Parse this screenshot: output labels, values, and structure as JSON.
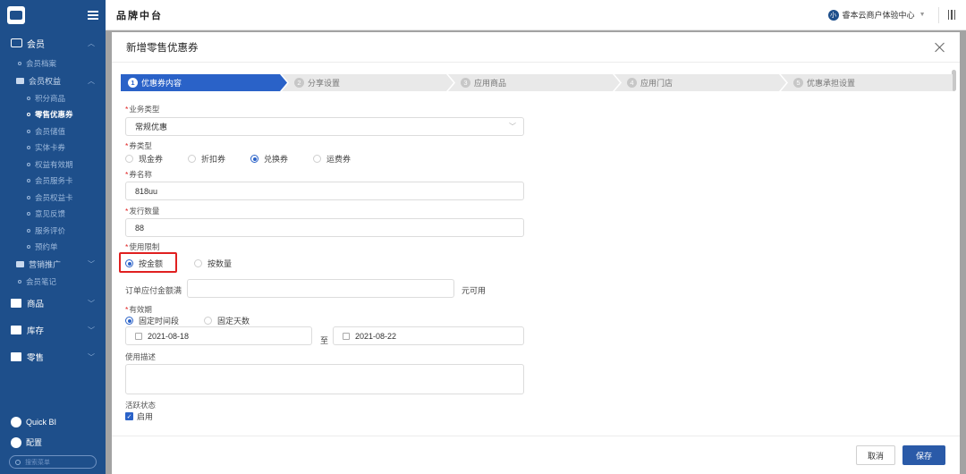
{
  "header": {
    "app_title": "品牌中台",
    "tenant_avatar": "小",
    "tenant_name": "睿本云商户体验中心"
  },
  "sidebar": {
    "section": "会员",
    "items": [
      {
        "label": "会员档案",
        "level": 1
      },
      {
        "label": "会员权益",
        "level": "group"
      },
      {
        "label": "积分商品",
        "level": 2
      },
      {
        "label": "零售优惠券",
        "level": 2,
        "active": true
      },
      {
        "label": "会员储值",
        "level": 2
      },
      {
        "label": "实体卡券",
        "level": 2
      },
      {
        "label": "权益有效期",
        "level": 2
      },
      {
        "label": "会员服务卡",
        "level": 2
      },
      {
        "label": "会员权益卡",
        "level": 2
      },
      {
        "label": "意见反馈",
        "level": 2
      },
      {
        "label": "服务评价",
        "level": 2
      },
      {
        "label": "预约单",
        "level": 2
      },
      {
        "label": "营销推广",
        "level": "group"
      },
      {
        "label": "会员笔记",
        "level": 1
      }
    ],
    "main_items": [
      "商品",
      "库存",
      "零售"
    ],
    "bottom_items": [
      "Quick BI",
      "配置"
    ],
    "search_placeholder": "搜索菜单"
  },
  "dialog": {
    "title": "新增零售优惠券",
    "steps": [
      {
        "num": "1",
        "label": "优惠券内容",
        "active": true
      },
      {
        "num": "2",
        "label": "分享设置"
      },
      {
        "num": "3",
        "label": "应用商品"
      },
      {
        "num": "4",
        "label": "应用门店"
      },
      {
        "num": "5",
        "label": "优惠承担设置"
      }
    ],
    "fields": {
      "business_type_label": "业务类型",
      "business_type_value": "常规优惠",
      "coupon_type_label": "券类型",
      "coupon_types": [
        "现金券",
        "折扣券",
        "兑换券",
        "运费券"
      ],
      "coupon_type_selected": "兑换券",
      "coupon_name_label": "券名称",
      "coupon_name_value": "818uu",
      "issue_qty_label": "发行数量",
      "issue_qty_value": "88",
      "usage_limit_label": "使用限制",
      "usage_limit_options": [
        "按金额",
        "按数量"
      ],
      "usage_limit_selected": "按金额",
      "order_amount_label": "订单应付金额满",
      "order_amount_value": "",
      "order_amount_unit": "元可用",
      "validity_label": "有效期",
      "validity_options": [
        "固定时间段",
        "固定天数"
      ],
      "validity_selected": "固定时间段",
      "date_start": "2021-08-18",
      "date_to": "至",
      "date_end": "2021-08-22",
      "description_label": "使用描述",
      "description_value": "",
      "active_status_label": "活跃状态",
      "active_checkbox_label": "启用"
    },
    "footer": {
      "cancel_label": "取消",
      "save_label": "保存"
    }
  },
  "colors": {
    "sidebar_bg": "#1e4f8b",
    "primary": "#2a62c8",
    "required": "#e02020",
    "highlight_box": "#e02020"
  }
}
